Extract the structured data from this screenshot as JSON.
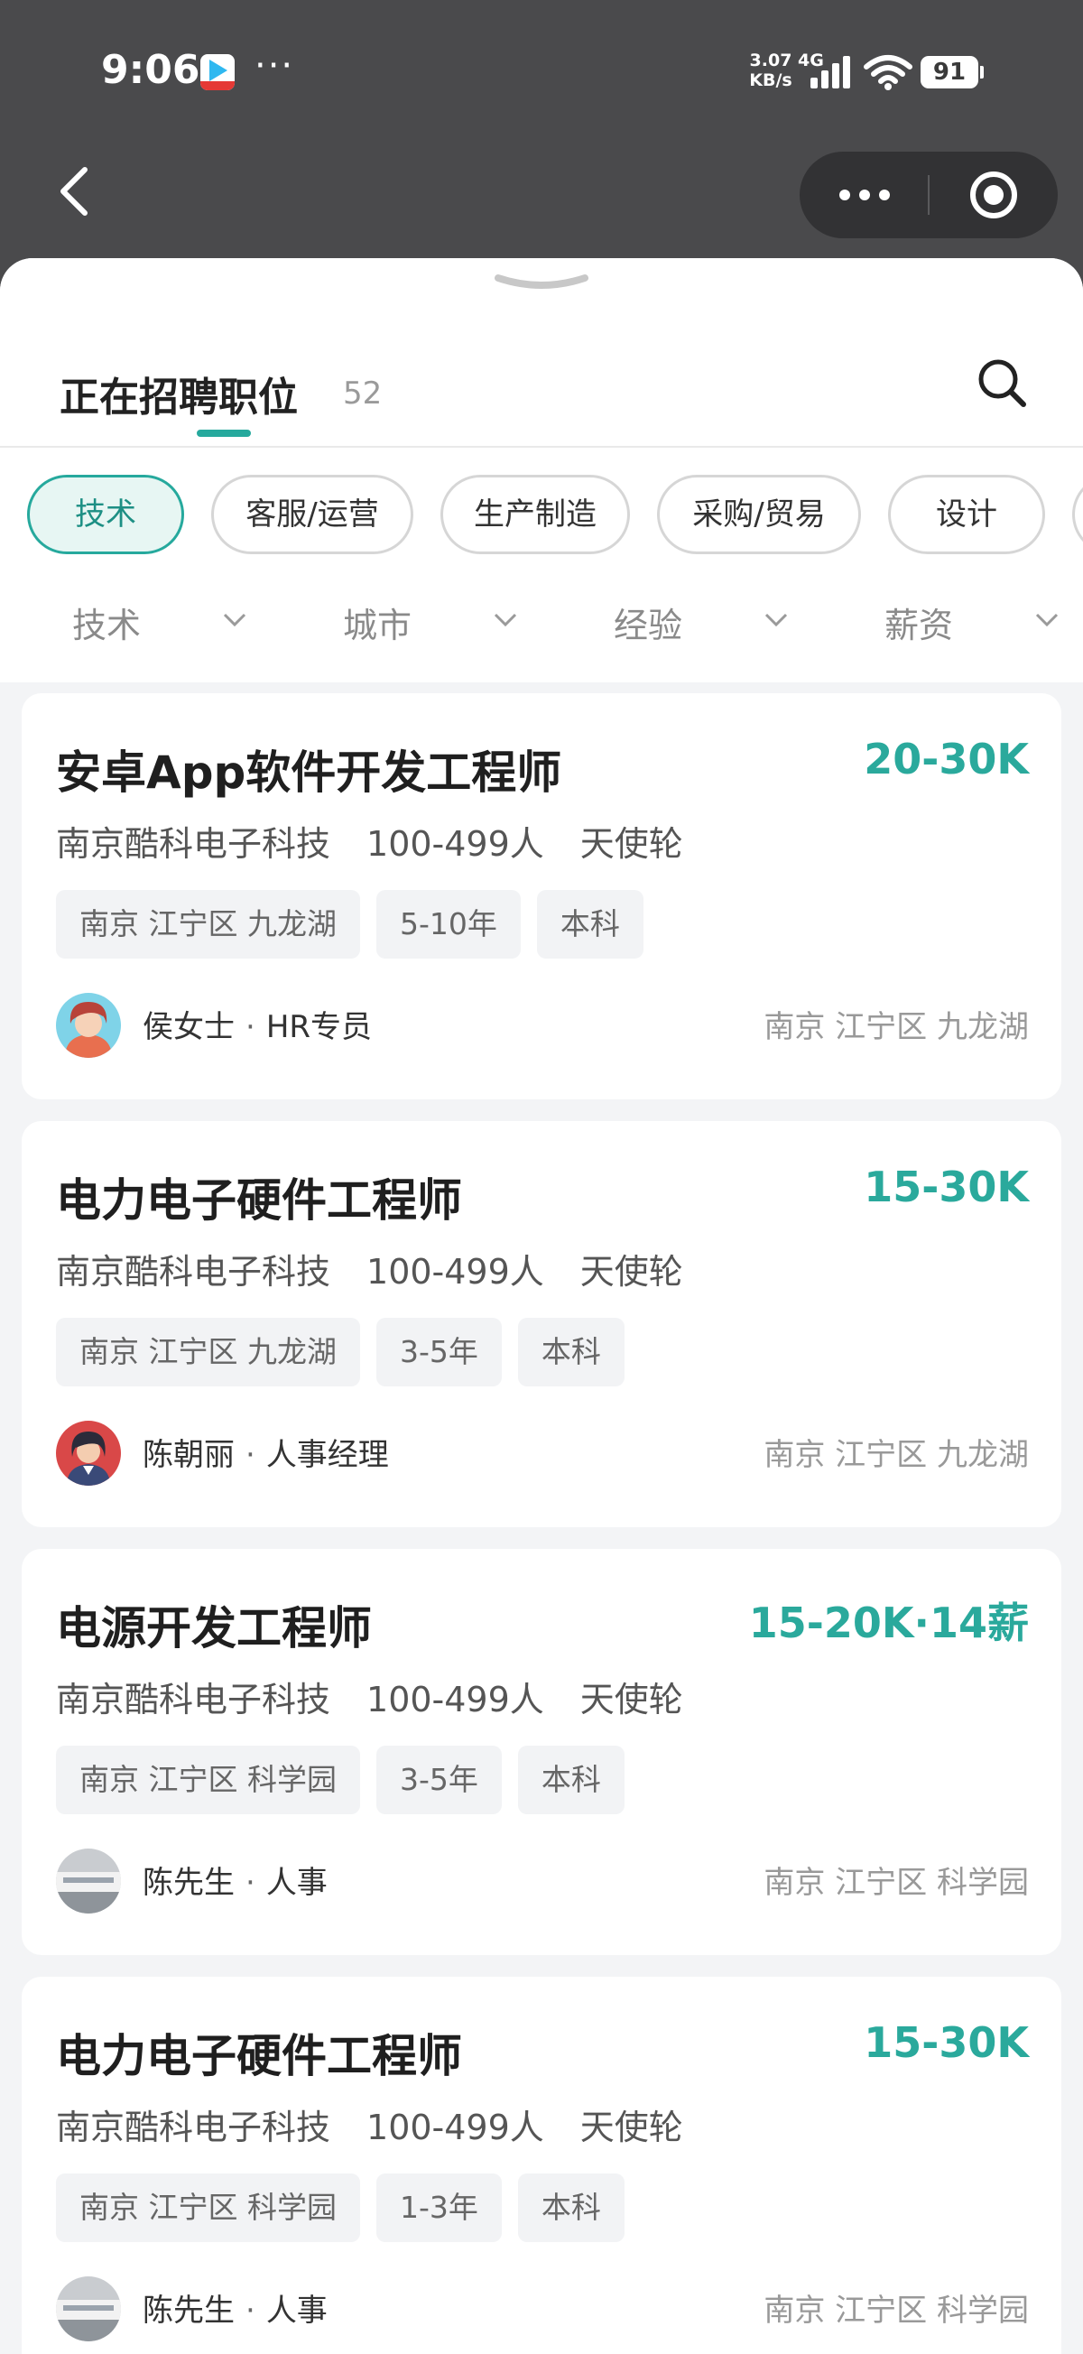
{
  "status_bar": {
    "time": "9:06",
    "more": "···",
    "net_speed_value": "3.07",
    "net_speed_unit": "KB/s",
    "network": "4G",
    "battery": "91"
  },
  "nav": {
    "back_icon": "chevron-left-icon",
    "more_icon": "more-dots-icon",
    "close_icon": "target-circle-icon"
  },
  "tab": {
    "title": "正在招聘职位",
    "count": "52"
  },
  "categories": [
    "技术",
    "客服/运营",
    "生产制造",
    "采购/贸易",
    "设计"
  ],
  "active_category": "技术",
  "filters": [
    "技术",
    "城市",
    "经验",
    "薪资"
  ],
  "jobs": [
    {
      "title": "安卓App软件开发工程师",
      "salary": "20-30K",
      "company": "南京酷科电子科技",
      "size": "100-499人",
      "stage": "天使轮",
      "tags": [
        "南京 江宁区 九龙湖",
        "5-10年",
        "本科"
      ],
      "recruiter_name": "侯女士",
      "recruiter_role": "HR专员",
      "location": "南京 江宁区 九龙湖"
    },
    {
      "title": "电力电子硬件工程师",
      "salary": "15-30K",
      "company": "南京酷科电子科技",
      "size": "100-499人",
      "stage": "天使轮",
      "tags": [
        "南京 江宁区 九龙湖",
        "3-5年",
        "本科"
      ],
      "recruiter_name": "陈朝丽",
      "recruiter_role": "人事经理",
      "location": "南京 江宁区 九龙湖"
    },
    {
      "title": "电源开发工程师",
      "salary": "15-20K·14薪",
      "company": "南京酷科电子科技",
      "size": "100-499人",
      "stage": "天使轮",
      "tags": [
        "南京 江宁区 科学园",
        "3-5年",
        "本科"
      ],
      "recruiter_name": "陈先生",
      "recruiter_role": "人事",
      "location": "南京 江宁区 科学园"
    },
    {
      "title": "电力电子硬件工程师",
      "salary": "15-30K",
      "company": "南京酷科电子科技",
      "size": "100-499人",
      "stage": "天使轮",
      "tags": [
        "南京 江宁区 科学园",
        "1-3年",
        "本科"
      ],
      "recruiter_name": "陈先生",
      "recruiter_role": "人事",
      "location": "南京 江宁区 科学园"
    }
  ],
  "colors": {
    "accent": "#26a99d",
    "salary": "#2aa99c",
    "topbar": "#4a4a4c"
  }
}
